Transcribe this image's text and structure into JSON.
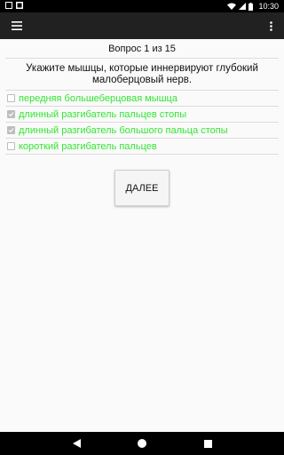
{
  "status_bar": {
    "time": "10:30",
    "left_icons": [
      "notification-square-icon",
      "image-icon"
    ],
    "right_icons": [
      "wifi-icon",
      "signal-icon",
      "battery-icon"
    ]
  },
  "app_bar": {
    "background": "#212121",
    "menu_icon": "hamburger-menu-icon",
    "overflow_icon": "more-vert-icon"
  },
  "quiz": {
    "counter": "Вопрос 1 из 15",
    "question": "Укажите мышцы, которые иннервируют глубокий малоберцовый нерв.",
    "answer_color": "#33e633",
    "answers": [
      {
        "label": "передняя большеберцовая мышца",
        "checked": false
      },
      {
        "label": "длинный разгибатель пальцев стопы",
        "checked": true
      },
      {
        "label": "длинный разгибатель большого пальца стопы",
        "checked": true
      },
      {
        "label": "короткий разгибатель пальцев",
        "checked": false
      }
    ],
    "next_label": "ДАЛЕЕ"
  },
  "nav_bar": {
    "icons": [
      "back-triangle-icon",
      "home-circle-icon",
      "recents-square-icon"
    ]
  }
}
